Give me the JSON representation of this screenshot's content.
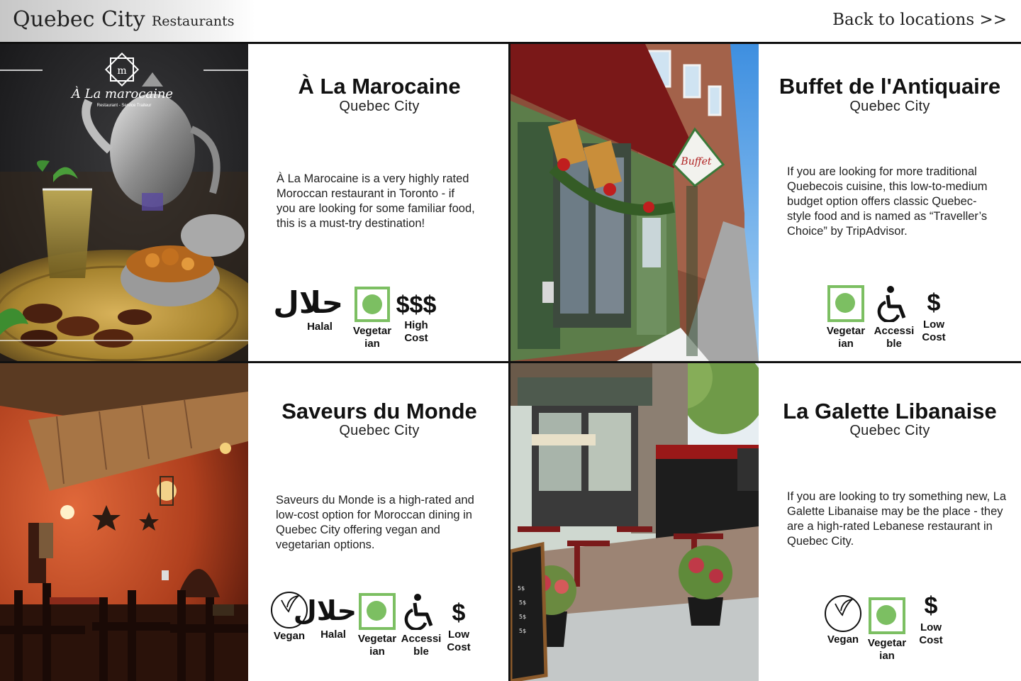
{
  "header": {
    "city": "Quebec City",
    "section": "Restaurants",
    "back_link": "Back to locations >>"
  },
  "restaurants": [
    {
      "name": "À La Marocaine",
      "city": "Quebec City",
      "description": "À La Marocaine is a very highly rated Moroccan restaurant in Toronto - if you are looking for some familiar food, this is a must-try destination!",
      "photo_logo": "À La marocaine",
      "photo_logo_sub": "Restaurant - Service Traiteur",
      "tags": [
        {
          "icon": "halal-icon",
          "label": "Halal",
          "glyph": "حلال"
        },
        {
          "icon": "vegetarian-icon",
          "label": "Vegetar ian"
        },
        {
          "icon": "dollar-icon",
          "label": "High Cost",
          "glyph": "$$$"
        }
      ]
    },
    {
      "name": "Buffet de l'Antiquaire",
      "city": "Quebec City",
      "description": "If you are looking for more traditional Quebecois cuisine, this low-to-medium budget option offers classic Quebec-style food and is named as “Traveller’s Choice” by TripAdvisor.",
      "photo_sign": "Buffet",
      "tags": [
        {
          "icon": "vegetarian-icon",
          "label": "Vegetar ian"
        },
        {
          "icon": "accessible-icon",
          "label": "Accessi ble"
        },
        {
          "icon": "dollar-icon",
          "label": "Low Cost",
          "glyph": "$"
        }
      ]
    },
    {
      "name": "Saveurs du Monde",
      "city": "Quebec City",
      "description": "Saveurs du Monde is a high-rated and low-cost option for Moroccan dining in Quebec City offering vegan and vegetarian options.",
      "tags": [
        {
          "icon": "vegan-icon",
          "label": "Vegan"
        },
        {
          "icon": "halal-icon",
          "label": "Halal",
          "glyph": "حلال"
        },
        {
          "icon": "vegetarian-icon",
          "label": "Vegetar ian"
        },
        {
          "icon": "accessible-icon",
          "label": "Accessi ble"
        },
        {
          "icon": "dollar-icon",
          "label": "Low Cost",
          "glyph": "$"
        }
      ]
    },
    {
      "name": "La Galette Libanaise",
      "city": "Quebec City",
      "description": "If you are looking to try something new, La Galette Libanaise may be the place - they are a high-rated Lebanese restaurant in Quebec City.",
      "tags": [
        {
          "icon": "vegan-icon",
          "label": "Vegan"
        },
        {
          "icon": "vegetarian-icon",
          "label": "Vegetar ian"
        },
        {
          "icon": "dollar-icon",
          "label": "Low Cost",
          "glyph": "$"
        }
      ]
    }
  ],
  "colors": {
    "vegetarian_green": "#7cbf62",
    "divider": "#111111"
  }
}
